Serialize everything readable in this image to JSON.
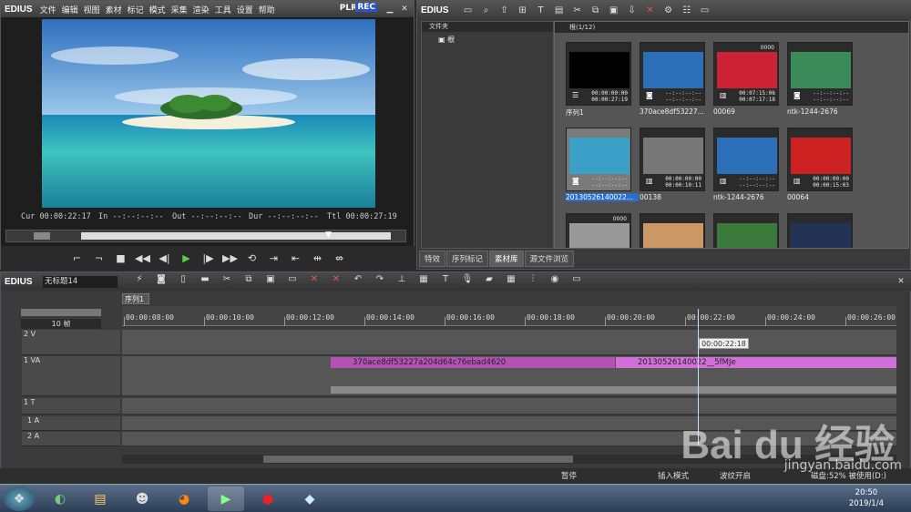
{
  "player": {
    "brand": "EDIUS",
    "menu": [
      "文件",
      "编辑",
      "视图",
      "素材",
      "标记",
      "模式",
      "采集",
      "渲染",
      "工具",
      "设置",
      "帮助"
    ],
    "plr": "PLR",
    "rec": "REC",
    "cur_label": "Cur",
    "cur": "00:00:22:17",
    "in_label": "In",
    "in": "--:--:--:--",
    "out_label": "Out",
    "out": "--:--:--:--",
    "dur_label": "Dur",
    "dur": "--:--:--:--",
    "ttl_label": "Ttl",
    "ttl": "00:00:27:19"
  },
  "bin": {
    "brand": "EDIUS",
    "folder_header": "文件夹",
    "root_label": "根",
    "clip_header": "根(1/12)",
    "clips": [
      {
        "name": "序列1",
        "top": "",
        "t1": "00:00:00:00",
        "t2": "00:00:27:19",
        "icon": "sequence-icon",
        "selected": false
      },
      {
        "name": "370ace8df53227...",
        "top": "",
        "t1": "--:--:--:--",
        "t2": "--:--:--:--",
        "icon": "camera-icon",
        "selected": false
      },
      {
        "name": "00069",
        "top": "0000",
        "t1": "00:07:15:06",
        "t2": "00:07:17:18",
        "icon": "film-icon",
        "selected": false
      },
      {
        "name": "ntk-1244-2676",
        "top": "",
        "t1": "--:--:--:--",
        "t2": "--:--:--:--",
        "icon": "camera-icon",
        "selected": false
      },
      {
        "name": "20130526140022...",
        "top": "",
        "t1": "--:--:--:--",
        "t2": "--:--:--:--",
        "icon": "camera-icon",
        "selected": true
      },
      {
        "name": "00138",
        "top": "",
        "t1": "00:00:00:00",
        "t2": "00:00:10:11",
        "icon": "film-icon",
        "selected": false
      },
      {
        "name": "ntk-1244-2676",
        "top": "",
        "t1": "--:--:--:--",
        "t2": "--:--:--:--",
        "icon": "film-icon",
        "selected": false
      },
      {
        "name": "00064",
        "top": "",
        "t1": "00:00:00:00",
        "t2": "00:00:15:03",
        "icon": "film-icon",
        "selected": false
      },
      {
        "name": "",
        "top": "0000",
        "t1": "",
        "t2": "",
        "icon": "",
        "selected": false
      },
      {
        "name": "",
        "top": "",
        "t1": "",
        "t2": "",
        "icon": "",
        "selected": false
      },
      {
        "name": "",
        "top": "",
        "t1": "",
        "t2": "",
        "icon": "",
        "selected": false
      },
      {
        "name": "",
        "top": "",
        "t1": "",
        "t2": "",
        "icon": "",
        "selected": false
      }
    ],
    "tabs": [
      "特效",
      "序列标记",
      "素材库",
      "源文件浏览"
    ]
  },
  "timeline": {
    "brand": "EDIUS",
    "sequence_name": "无标题14",
    "sequence_tab": "序列1",
    "zoom": "10 帧",
    "ruler": [
      "00:00:08:00",
      "00:00:10:00",
      "00:00:12:00",
      "00:00:14:00",
      "00:00:16:00",
      "00:00:18:00",
      "00:00:20:00",
      "00:00:22:00",
      "00:00:24:00",
      "00:00:26:00"
    ],
    "playhead_tc": "00:00:22:18",
    "tracks": {
      "v2": "2 V",
      "va1": "1 VA",
      "t1": "1 T",
      "a1": "1 A",
      "a2": "2 A"
    },
    "clip1": "370ace8df53227a204d64c76ebad4620",
    "clip2": "20130526140022__5fMJe",
    "status": {
      "pause": "暂停",
      "insert": "插入模式",
      "wave": "波纹开启",
      "disk": "磁盘:52% 被使用(D:)"
    }
  },
  "taskbar": {
    "time": "20:50",
    "date": "2019/1/4"
  },
  "watermark": {
    "logo": "Bai du 经验",
    "url": "jingyan.baidu.com"
  }
}
